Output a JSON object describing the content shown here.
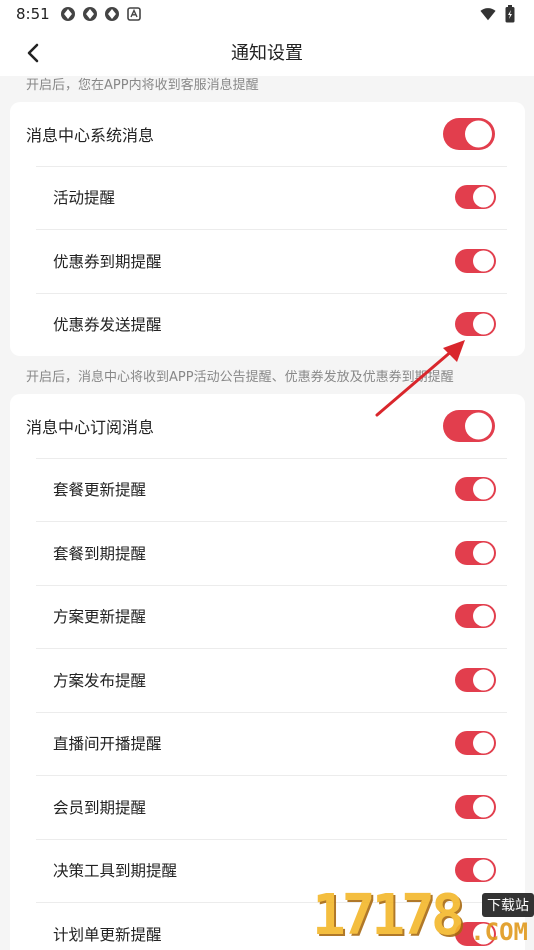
{
  "status_bar": {
    "time": "8:51"
  },
  "header": {
    "title": "通知设置"
  },
  "sections": [
    {
      "note": "开启后，您在APP内将收到客服消息提醒",
      "main": {
        "label": "消息中心系统消息",
        "on": true
      },
      "items": [
        {
          "label": "活动提醒",
          "on": true
        },
        {
          "label": "优惠券到期提醒",
          "on": true
        },
        {
          "label": "优惠券发送提醒",
          "on": true
        }
      ]
    },
    {
      "note": "开启后，消息中心将收到APP活动公告提醒、优惠券发放及优惠券到期提醒",
      "main": {
        "label": "消息中心订阅消息",
        "on": true
      },
      "items": [
        {
          "label": "套餐更新提醒",
          "on": true
        },
        {
          "label": "套餐到期提醒",
          "on": true
        },
        {
          "label": "方案更新提醒",
          "on": true
        },
        {
          "label": "方案发布提醒",
          "on": true
        },
        {
          "label": "直播间开播提醒",
          "on": true
        },
        {
          "label": "会员到期提醒",
          "on": true
        },
        {
          "label": "决策工具到期提醒",
          "on": true
        },
        {
          "label": "计划单更新提醒",
          "on": true
        }
      ]
    }
  ],
  "watermark": {
    "digits": "17178",
    "tag": "下载站",
    "suffix": ".COM"
  },
  "colors": {
    "toggle_on": "#e23e4d",
    "annotation_arrow": "#d9262c",
    "background": "#f5f5f5"
  }
}
